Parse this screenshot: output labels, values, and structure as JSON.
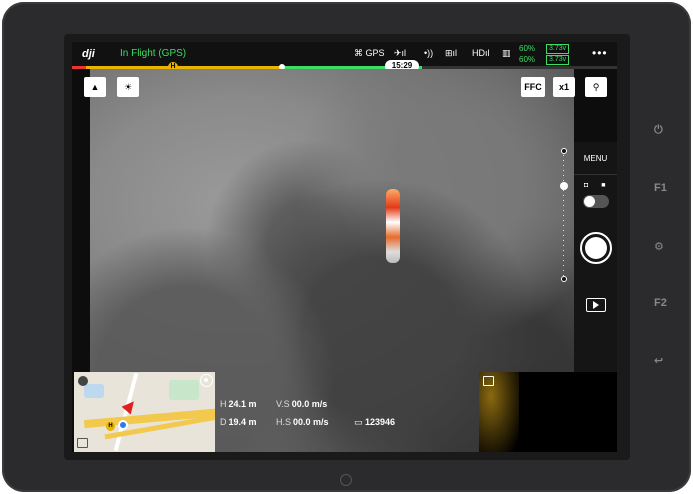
{
  "status_bar": {
    "logo": "dji",
    "flight_status": "In Flight (GPS)",
    "gps_label": "GPS",
    "gps_icon": "satellite-icon",
    "rc_icon": "remote-signal-icon",
    "hd_label": "HD",
    "battery_pct_1": "60%",
    "battery_pct_2": "60%",
    "voltage_1": "3.73v",
    "voltage_2": "3.73v",
    "more": "•••"
  },
  "flight_bar": {
    "home_marker": "H",
    "flight_time": "15:29"
  },
  "camera_controls": {
    "ffc_label": "FFC",
    "zoom_label": "x1",
    "menu_label": "MENU"
  },
  "map": {
    "home_marker": "H"
  },
  "telemetry": {
    "height_label": "H",
    "height_value": "24.1 m",
    "distance_label": "D",
    "distance_value": "19.4 m",
    "vspeed_label": "V.S",
    "vspeed_value": "00.0 m/s",
    "hspeed_label": "H.S",
    "hspeed_value": "00.0 m/s",
    "record_counter": "123946"
  },
  "device_buttons": {
    "f1_label": "F1",
    "f2_label": "F2"
  },
  "colors": {
    "accent_green": "#3ddc64",
    "warning_yellow": "#e8b400",
    "alert_red": "#e33333"
  }
}
